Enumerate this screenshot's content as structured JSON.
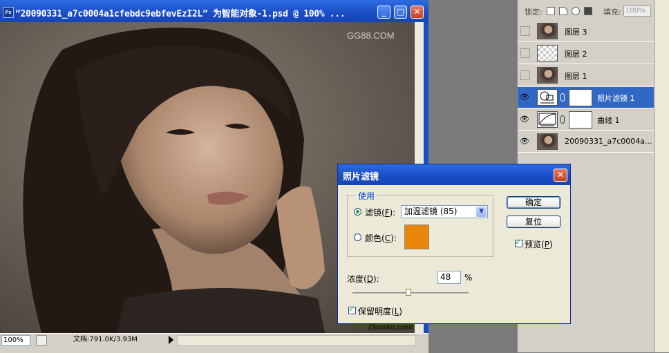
{
  "document": {
    "title": "“20090331_a7c0004a1cfebdc9ebfevEzI2L” 为智能对象-1.psd @ 100% ...",
    "app_icon": "Ps",
    "watermark_top": "GG88.COM",
    "watermark_bottom": "Zhuoku.com",
    "zoom": "100%",
    "doc_info": "文档:791.0K/3.93M"
  },
  "layers_panel": {
    "lock_label": "锁定:",
    "fill_label": "填充:",
    "fill_value": "100%",
    "layers": [
      {
        "name": "图层 3",
        "visible": false,
        "thumb": "photo"
      },
      {
        "name": "图层 2",
        "visible": false,
        "thumb": "transparent"
      },
      {
        "name": "图层 1",
        "visible": false,
        "thumb": "photo"
      },
      {
        "name": "照片滤镜 1",
        "visible": true,
        "thumb": "photo-filter-adjustment",
        "selected": true
      },
      {
        "name": "曲线 1",
        "visible": true,
        "thumb": "curves-adjustment"
      },
      {
        "name": "20090331_a7c0004a...",
        "visible": true,
        "thumb": "photo"
      }
    ]
  },
  "dialog": {
    "title": "照片滤镜",
    "group_label": "使用",
    "filter_label": "滤镜(",
    "filter_key": "F",
    "filter_value": "加温滤镜 (85)",
    "color_label": "颜色(",
    "color_key": "C",
    "color_value": "#e8870a",
    "density_label": "浓度(",
    "density_key": "D",
    "density_value": "48",
    "density_unit": "%",
    "density_fraction": 0.48,
    "preserve_label": "保留明度(",
    "preserve_key": "L",
    "preserve_checked": true,
    "ok_label": "确定",
    "reset_label": "复位",
    "preview_label": "预览(",
    "preview_key": "P",
    "preview_checked": true
  },
  "colors": {
    "titlebar": "#1a4cc4",
    "selection": "#3168c6",
    "filter_color": "#e8870a"
  }
}
